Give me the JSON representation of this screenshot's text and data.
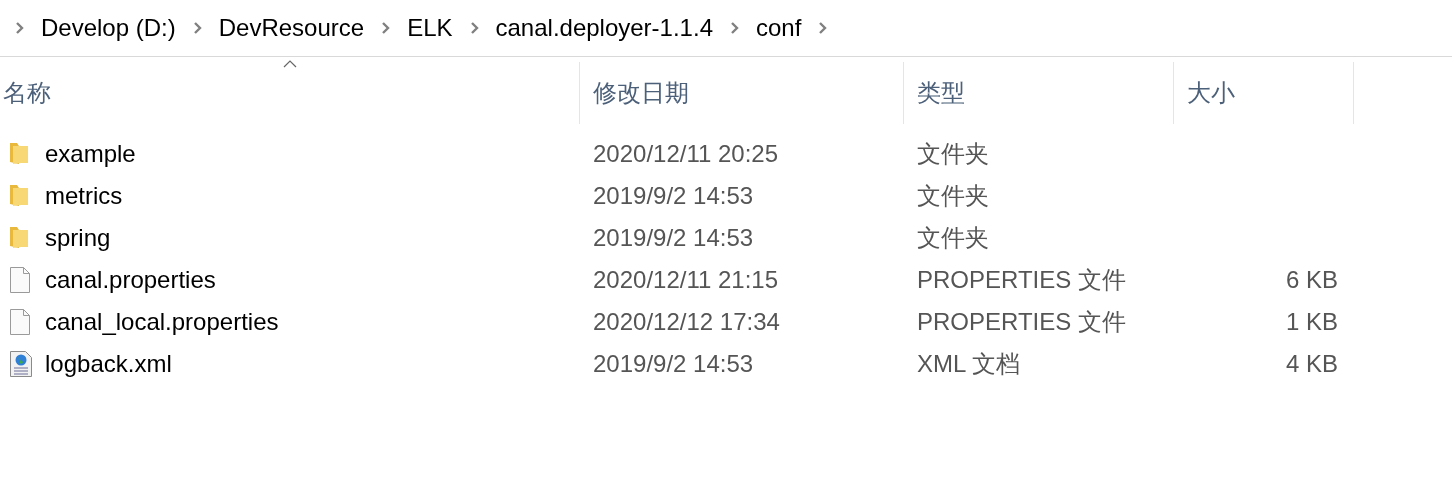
{
  "path_bar": {
    "segments": [
      "Develop (D:)",
      "DevResource",
      "ELK",
      "canal.deployer-1.1.4",
      "conf"
    ]
  },
  "file_list": {
    "columns": [
      {
        "label": "名称",
        "sorted_ascending": true
      },
      {
        "label": "修改日期",
        "sorted_ascending": false
      },
      {
        "label": "类型",
        "sorted_ascending": false
      },
      {
        "label": "大小",
        "sorted_ascending": false
      }
    ],
    "rows": [
      {
        "kind": "folder",
        "name": "example",
        "modified": "2020/12/11 20:25",
        "type": "文件夹"
      },
      {
        "kind": "folder",
        "name": "metrics",
        "modified": "2019/9/2 14:53",
        "type": "文件夹"
      },
      {
        "kind": "folder",
        "name": "spring",
        "modified": "2019/9/2 14:53",
        "type": "文件夹"
      },
      {
        "kind": "file",
        "name": "canal.properties",
        "modified": "2020/12/11 21:15",
        "type": "PROPERTIES 文件",
        "size": "6 KB"
      },
      {
        "kind": "file",
        "name": "canal_local.properties",
        "modified": "2020/12/12 17:34",
        "type": "PROPERTIES 文件",
        "size": "1 KB"
      },
      {
        "kind": "xml",
        "name": "logback.xml",
        "modified": "2019/9/2 14:53",
        "type": "XML 文档",
        "size": "4 KB"
      }
    ]
  }
}
